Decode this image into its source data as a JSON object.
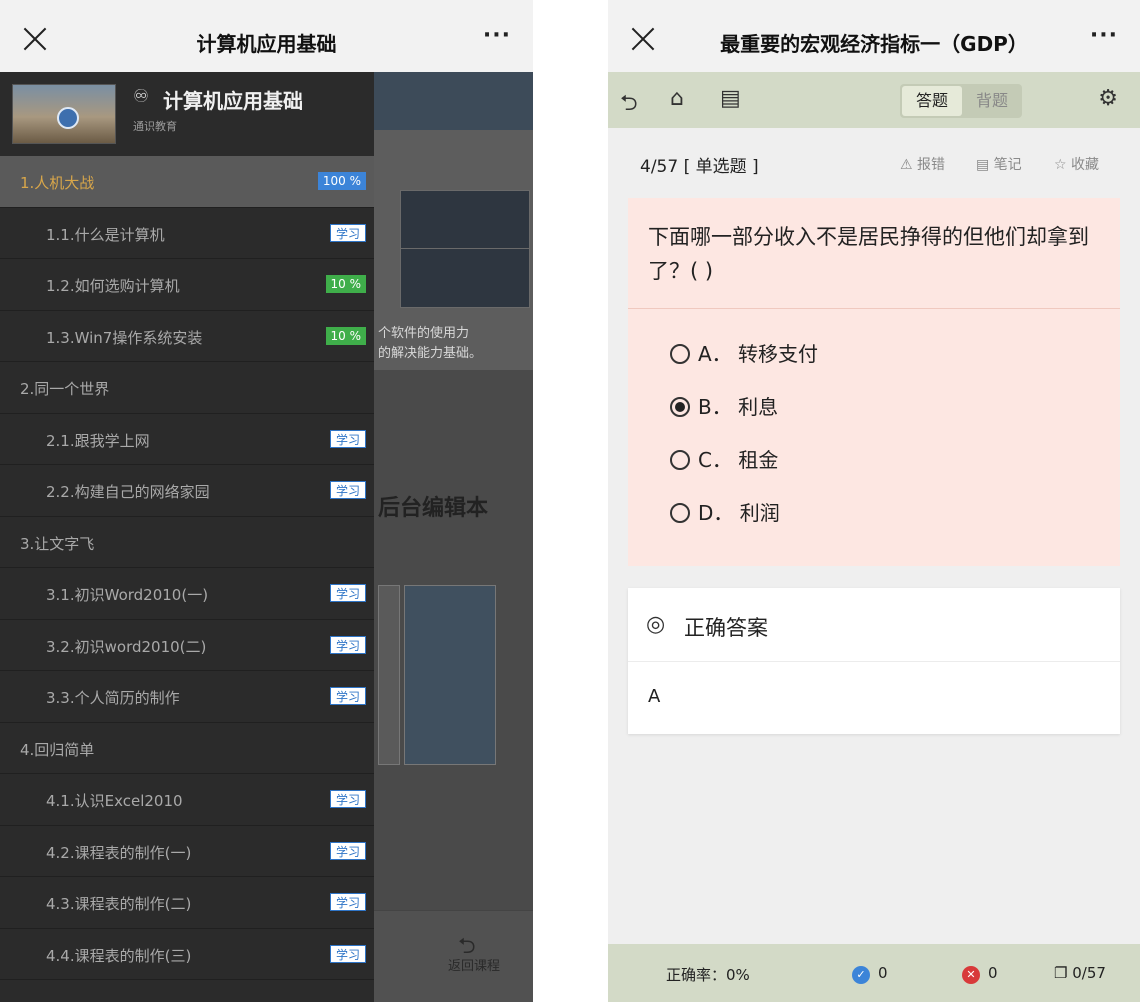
{
  "left": {
    "nav": {
      "title": "计算机应用基础",
      "more": "···"
    },
    "course": {
      "icon": "♾",
      "title": "计算机应用基础",
      "subtitle": "通识教育"
    },
    "items": [
      {
        "label": "1.人机大战",
        "kind": "chapter",
        "active": true,
        "badge": "100 %",
        "badge_style": "pct-blue"
      },
      {
        "label": "1.1.什么是计算机",
        "kind": "lesson",
        "badge": "学习",
        "badge_style": "learn"
      },
      {
        "label": "1.2.如何选购计算机",
        "kind": "lesson",
        "badge": "10 %",
        "badge_style": "pct-green"
      },
      {
        "label": "1.3.Win7操作系统安装",
        "kind": "lesson",
        "badge": "10 %",
        "badge_style": "pct-green"
      },
      {
        "label": "2.同一个世界",
        "kind": "chapter"
      },
      {
        "label": "2.1.跟我学上网",
        "kind": "lesson",
        "badge": "学习",
        "badge_style": "learn"
      },
      {
        "label": "2.2.构建自己的网络家园",
        "kind": "lesson",
        "badge": "学习",
        "badge_style": "learn"
      },
      {
        "label": "3.让文字飞",
        "kind": "chapter"
      },
      {
        "label": "3.1.初识Word2010(一)",
        "kind": "lesson",
        "badge": "学习",
        "badge_style": "learn"
      },
      {
        "label": "3.2.初识word2010(二)",
        "kind": "lesson",
        "badge": "学习",
        "badge_style": "learn"
      },
      {
        "label": "3.3.个人简历的制作",
        "kind": "lesson",
        "badge": "学习",
        "badge_style": "learn"
      },
      {
        "label": "4.回归简单",
        "kind": "chapter"
      },
      {
        "label": "4.1.认识Excel2010",
        "kind": "lesson",
        "badge": "学习",
        "badge_style": "learn"
      },
      {
        "label": "4.2.课程表的制作(一)",
        "kind": "lesson",
        "badge": "学习",
        "badge_style": "learn"
      },
      {
        "label": "4.3.课程表的制作(二)",
        "kind": "lesson",
        "badge": "学习",
        "badge_style": "learn"
      },
      {
        "label": "4.4.课程表的制作(三)",
        "kind": "lesson",
        "badge": "学习",
        "badge_style": "learn"
      }
    ],
    "background": {
      "text1": "个软件的使用力",
      "text2": "的解决能力基础。",
      "big_text": "后台编辑本",
      "back_btn": "返回课程"
    }
  },
  "right": {
    "nav": {
      "title": "最重要的宏观经济指标一（GDP）",
      "more": "···"
    },
    "toolbar": {
      "mode_answer": "答题",
      "mode_recite": "背题"
    },
    "question": {
      "number": "4/57",
      "type": "[ 单选题 ]",
      "report": "⚠ 报错",
      "note": "▤ 笔记",
      "fav": "☆ 收藏",
      "text": "下面哪一部分收入不是居民挣得的但他们却拿到了？( )",
      "options": [
        {
          "text": "A．  转移支付",
          "checked": false
        },
        {
          "text": "B．  利息",
          "checked": true
        },
        {
          "text": "C．  租金",
          "checked": false
        },
        {
          "text": "D．  利润",
          "checked": false
        }
      ]
    },
    "answer": {
      "title": "正确答案",
      "value": "A"
    },
    "footer": {
      "accuracy": "正确率：0%",
      "correct": "0",
      "wrong": "0",
      "progress": "0/57"
    }
  }
}
